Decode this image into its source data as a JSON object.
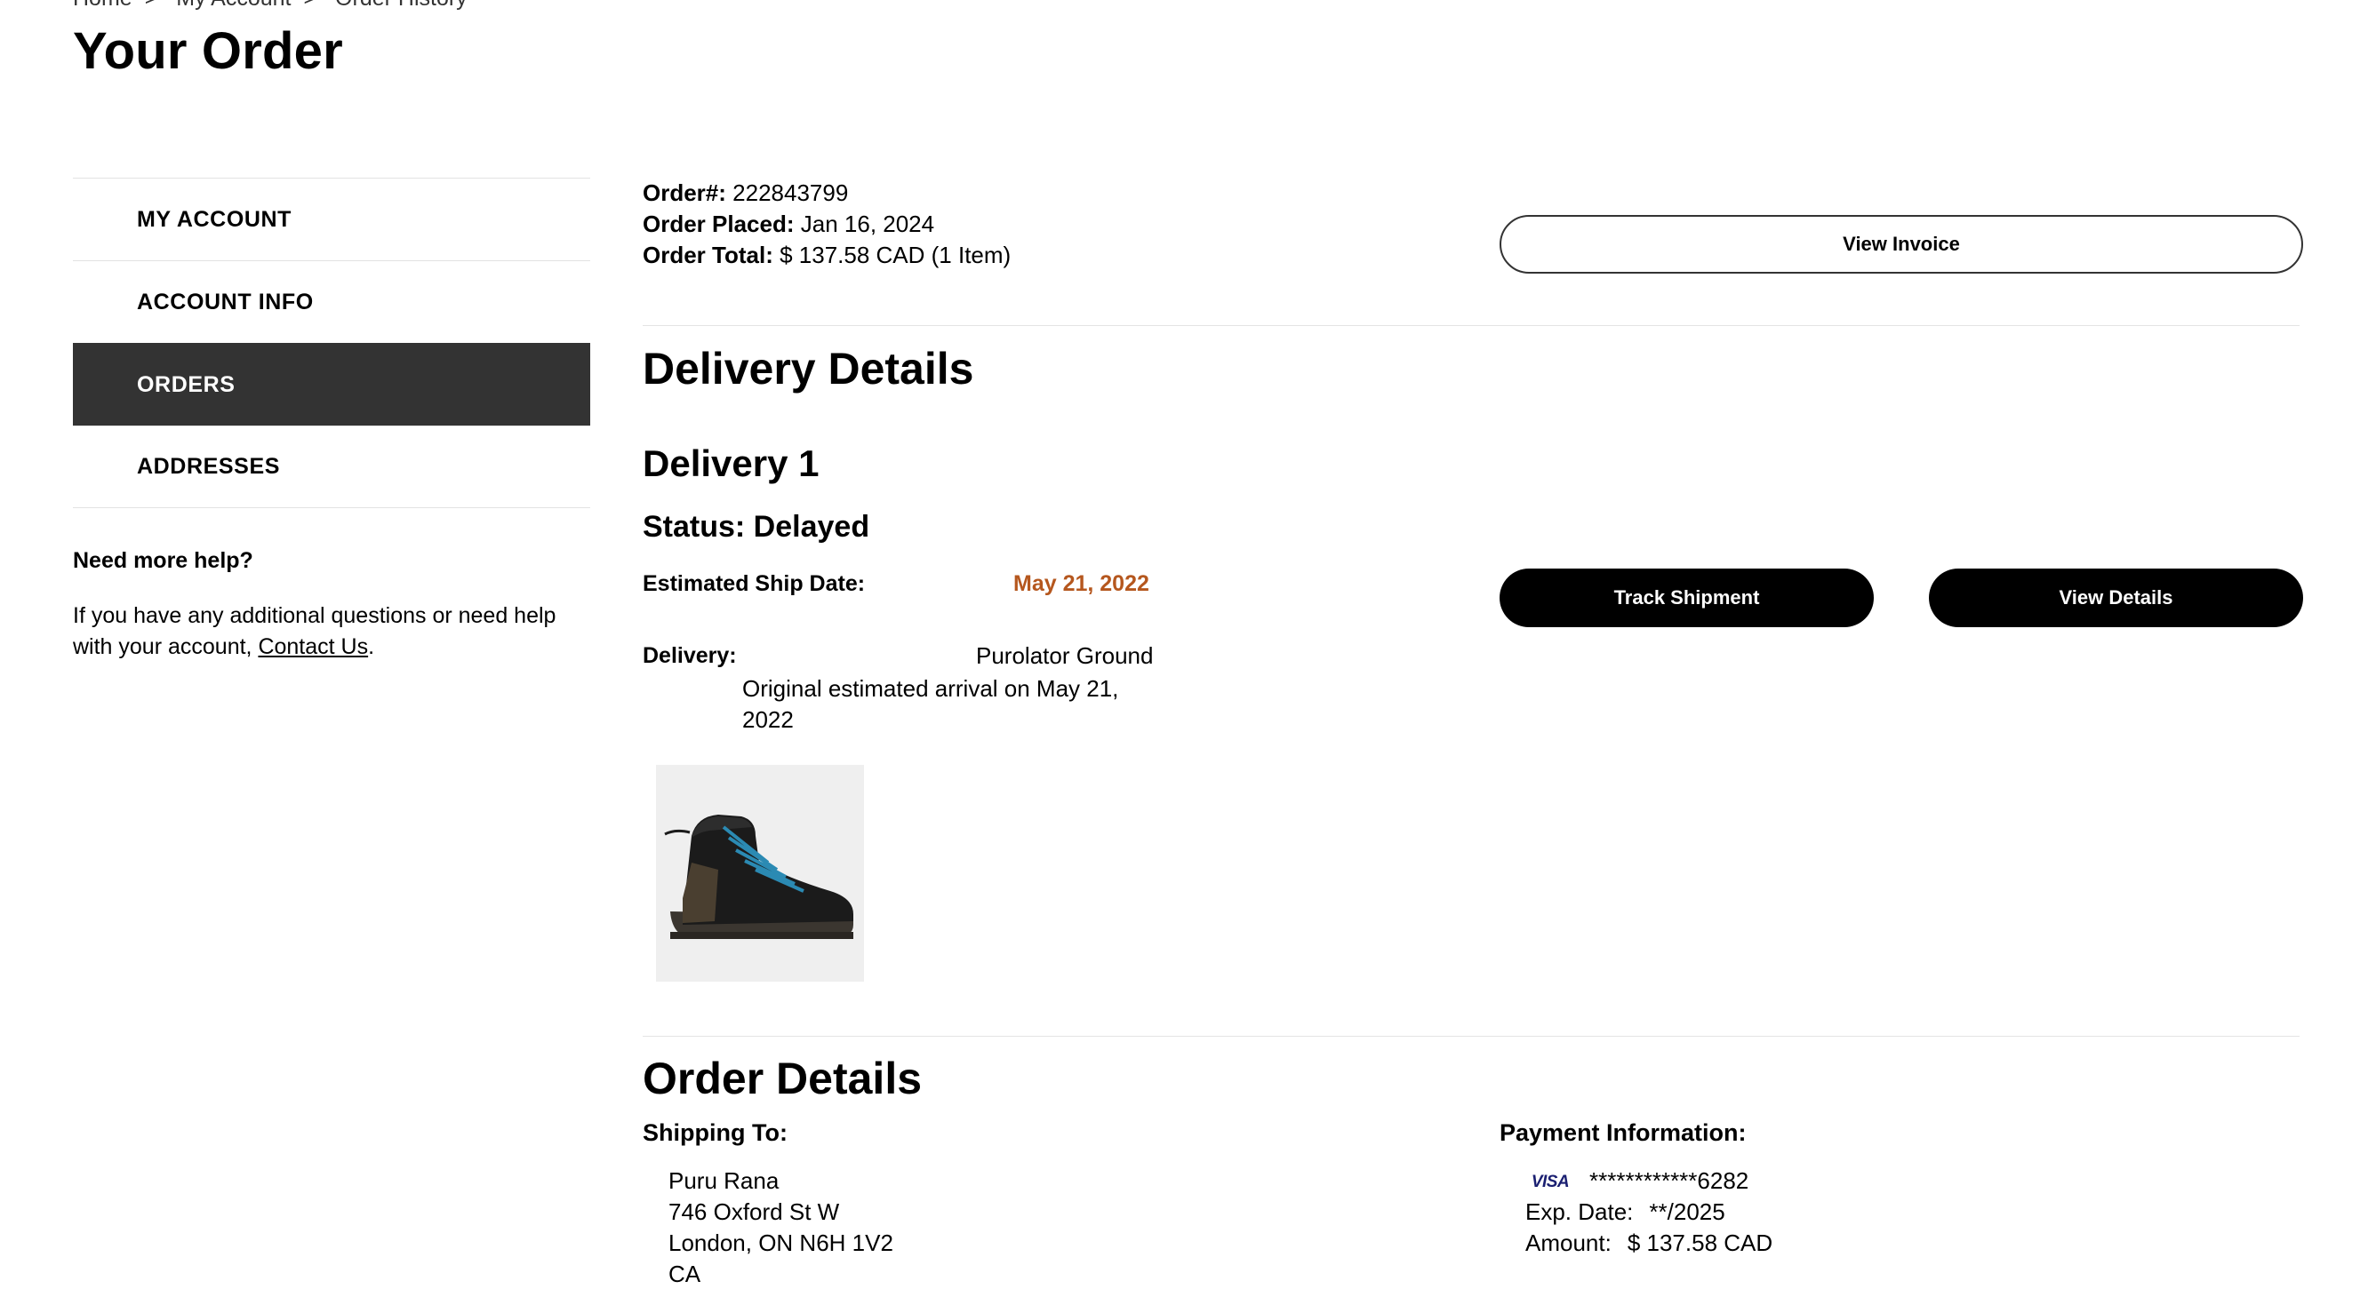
{
  "breadcrumb": [
    "Home",
    "My Account",
    "Order History"
  ],
  "page_title": "Your Order",
  "sidebar": {
    "items": [
      {
        "label": "MY ACCOUNT",
        "active": false
      },
      {
        "label": "ACCOUNT INFO",
        "active": false
      },
      {
        "label": "ORDERS",
        "active": true
      },
      {
        "label": "ADDRESSES",
        "active": false
      }
    ],
    "help_title": "Need more help?",
    "help_text": "If you have any additional questions or need help with your account, ",
    "help_link": "Contact Us",
    "help_suffix": "."
  },
  "order": {
    "number_label": "Order#:",
    "number": "222843799",
    "placed_label": "Order Placed:",
    "placed": "Jan 16, 2024",
    "total_label": "Order Total:",
    "total": "$ 137.58 CAD (1 Item)",
    "view_invoice": "View Invoice"
  },
  "delivery": {
    "section_title": "Delivery Details",
    "title": "Delivery 1",
    "status": "Status: Delayed",
    "ship_date_label": "Estimated Ship Date:",
    "ship_date": "May 21, 2022",
    "delivery_label": "Delivery:",
    "method": "Purolator Ground",
    "note": "Original estimated arrival on May 21, 2022",
    "track_button": "Track Shipment",
    "details_button": "View Details",
    "status_color": "#b5571e"
  },
  "order_details": {
    "section_title": "Order Details",
    "shipping_label": "Shipping To:",
    "shipping": {
      "name": "Puru Rana",
      "street": "746 Oxford St W",
      "city": "London, ON N6H 1V2",
      "country": "CA"
    },
    "payment_label": "Payment Information:",
    "payment": {
      "card_brand": "VISA",
      "card_number": "************6282",
      "exp_label": "Exp. Date:",
      "exp": "**/2025",
      "amount_label": "Amount:",
      "amount": "$ 137.58 CAD"
    }
  }
}
